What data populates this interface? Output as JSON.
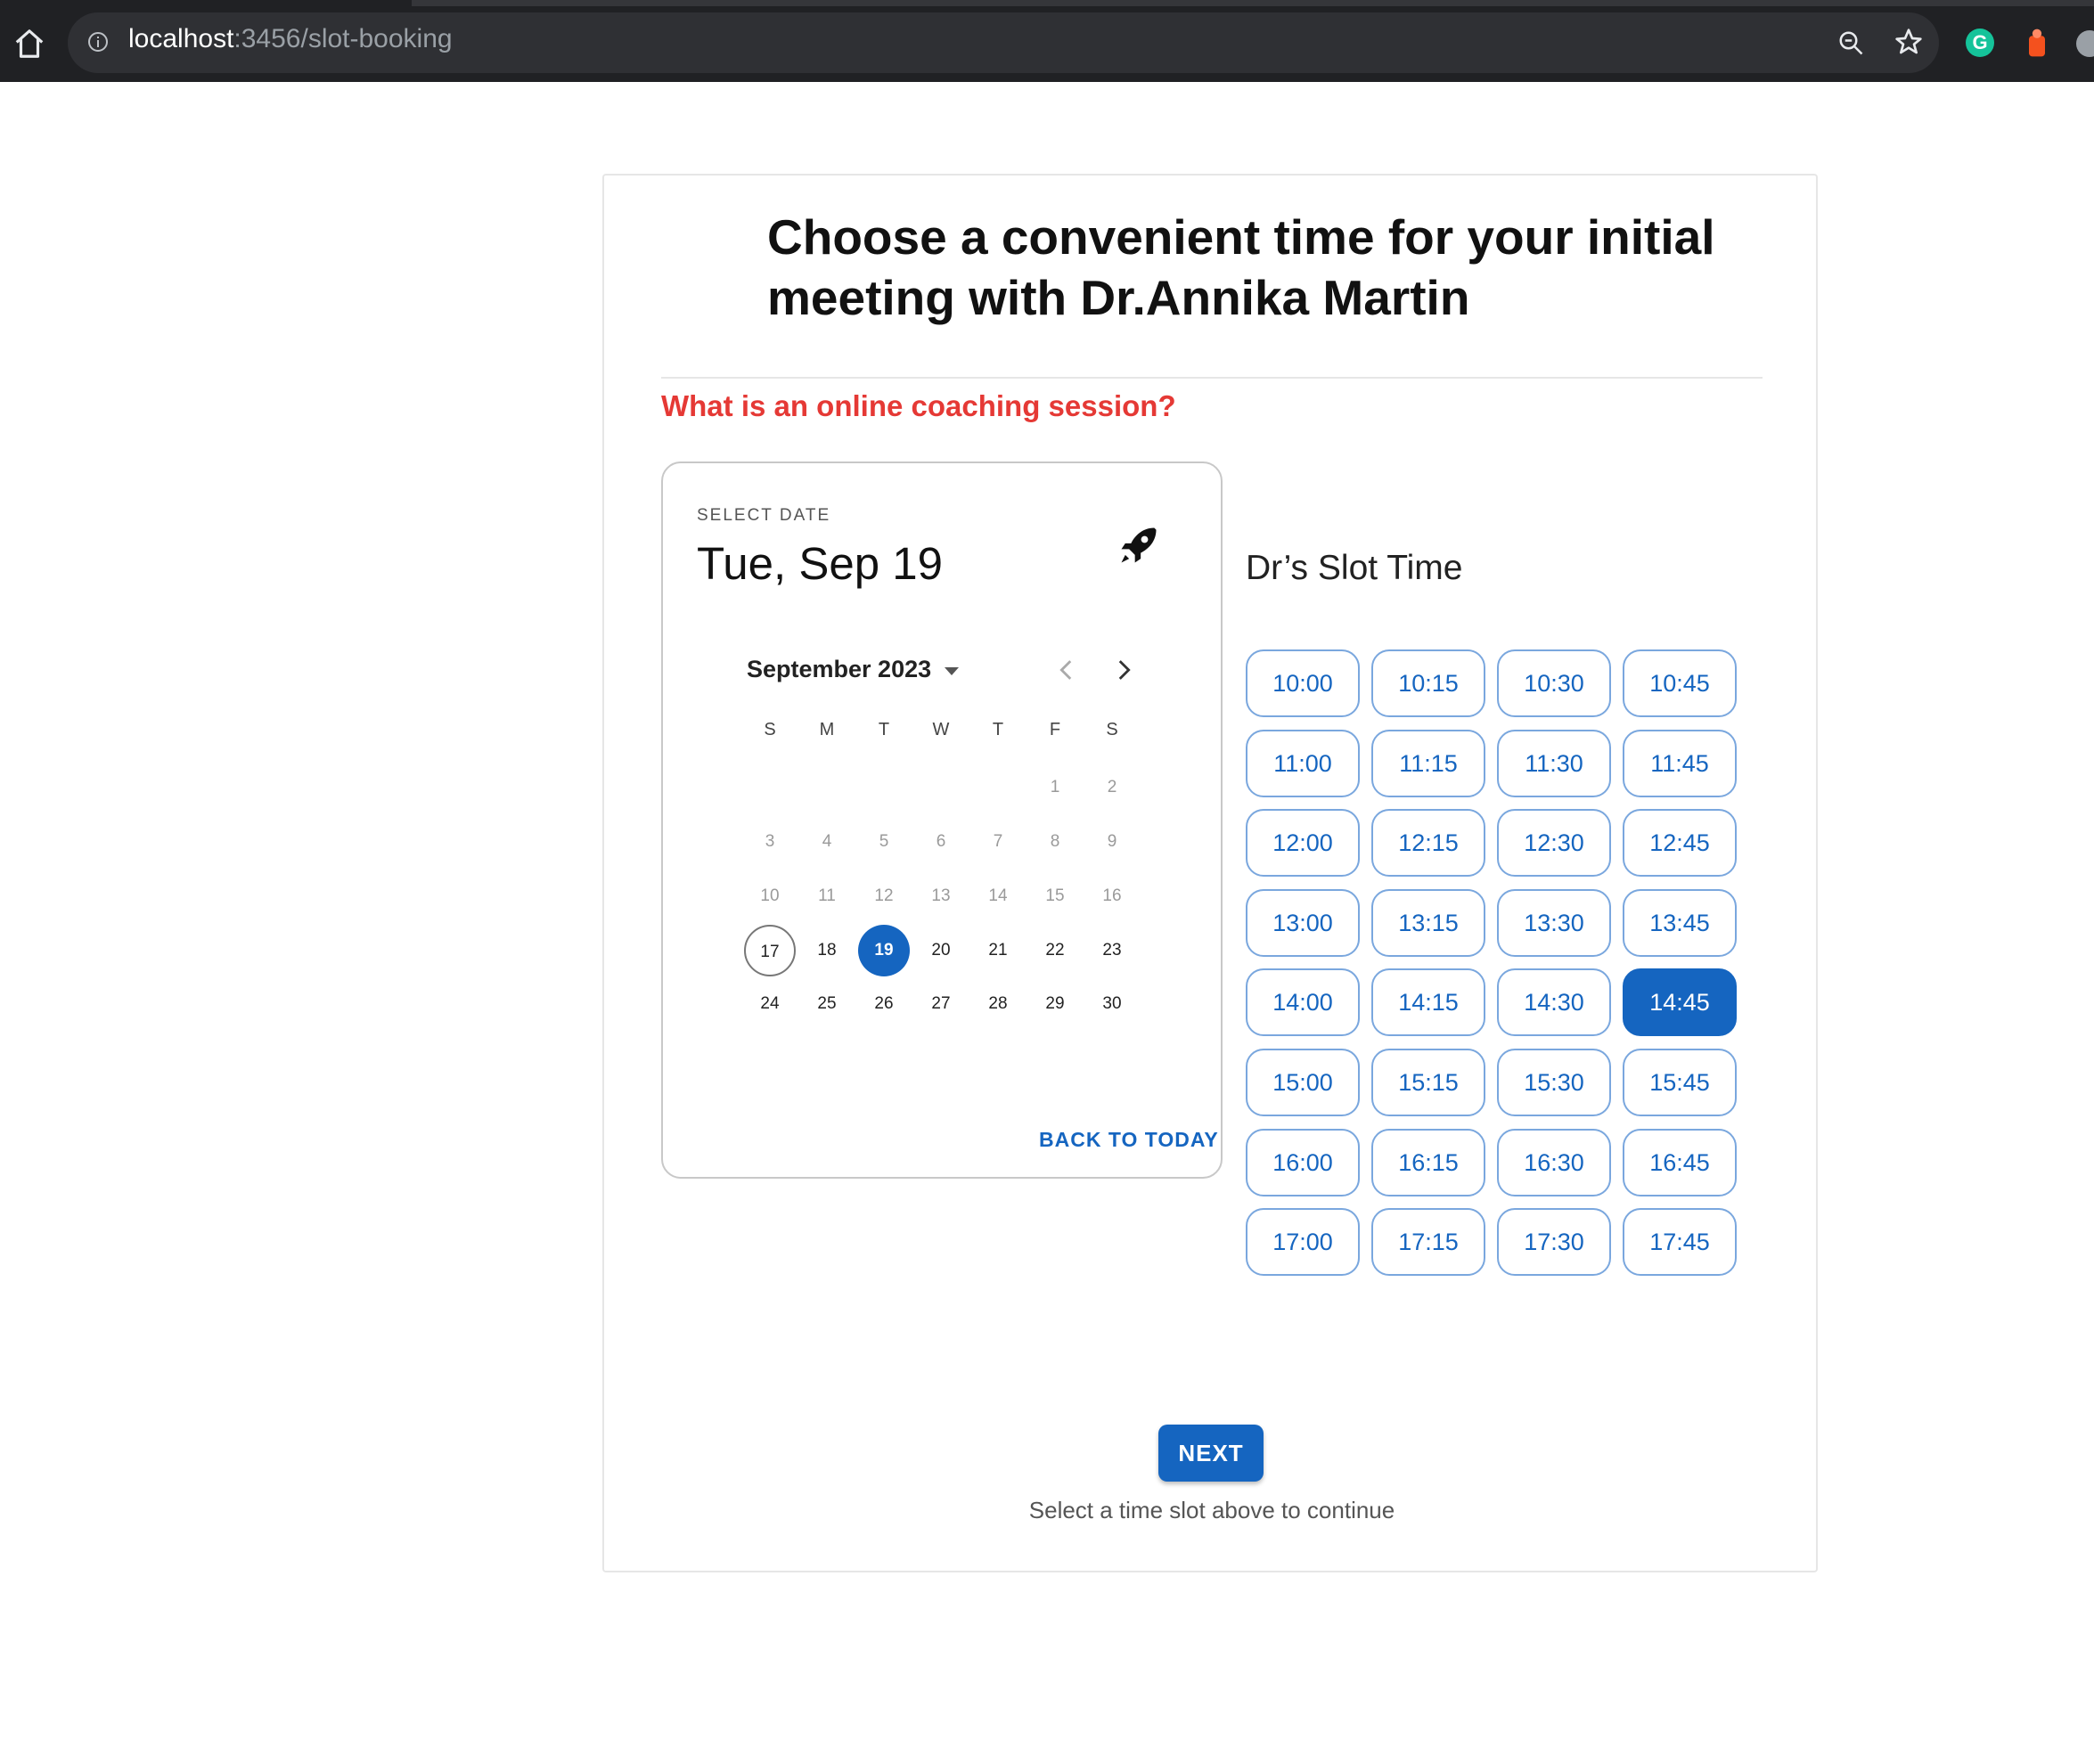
{
  "browser": {
    "url_host": "localhost",
    "url_path": ":3456/slot-booking",
    "icons": [
      "home-icon",
      "info-icon",
      "zoom-icon",
      "star-icon",
      "grammarly-icon",
      "extension-icon",
      "profile-icon"
    ],
    "grammarly_letter": "G"
  },
  "page": {
    "title": "Choose a convenient time for your initial meeting with Dr.Annika Martin",
    "coaching_link": "What is an online coaching session?"
  },
  "calendar": {
    "select_label": "SELECT DATE",
    "selected_date": "Tue, Sep 19",
    "month_label": "September 2023",
    "weekdays": [
      "S",
      "M",
      "T",
      "W",
      "T",
      "F",
      "S"
    ],
    "weeks": [
      [
        "",
        "",
        "",
        "",
        "",
        "1",
        "2"
      ],
      [
        "3",
        "4",
        "5",
        "6",
        "7",
        "8",
        "9"
      ],
      [
        "10",
        "11",
        "12",
        "13",
        "14",
        "15",
        "16"
      ],
      [
        "17",
        "18",
        "19",
        "20",
        "21",
        "22",
        "23"
      ],
      [
        "24",
        "25",
        "26",
        "27",
        "28",
        "29",
        "30"
      ]
    ],
    "today": "17",
    "selected": "19",
    "back_to_today": "BACK TO TODAY"
  },
  "slots": {
    "title": "Dr’s Slot Time",
    "times": [
      "10:00",
      "10:15",
      "10:30",
      "10:45",
      "11:00",
      "11:15",
      "11:30",
      "11:45",
      "12:00",
      "12:15",
      "12:30",
      "12:45",
      "13:00",
      "13:15",
      "13:30",
      "13:45",
      "14:00",
      "14:15",
      "14:30",
      "14:45",
      "15:00",
      "15:15",
      "15:30",
      "15:45",
      "16:00",
      "16:15",
      "16:30",
      "16:45",
      "17:00",
      "17:15",
      "17:30",
      "17:45"
    ],
    "selected": "14:45",
    "accent_color": "#1565c0"
  },
  "footer": {
    "next_label": "NEXT",
    "helper_text": "Select a time slot above to continue"
  }
}
